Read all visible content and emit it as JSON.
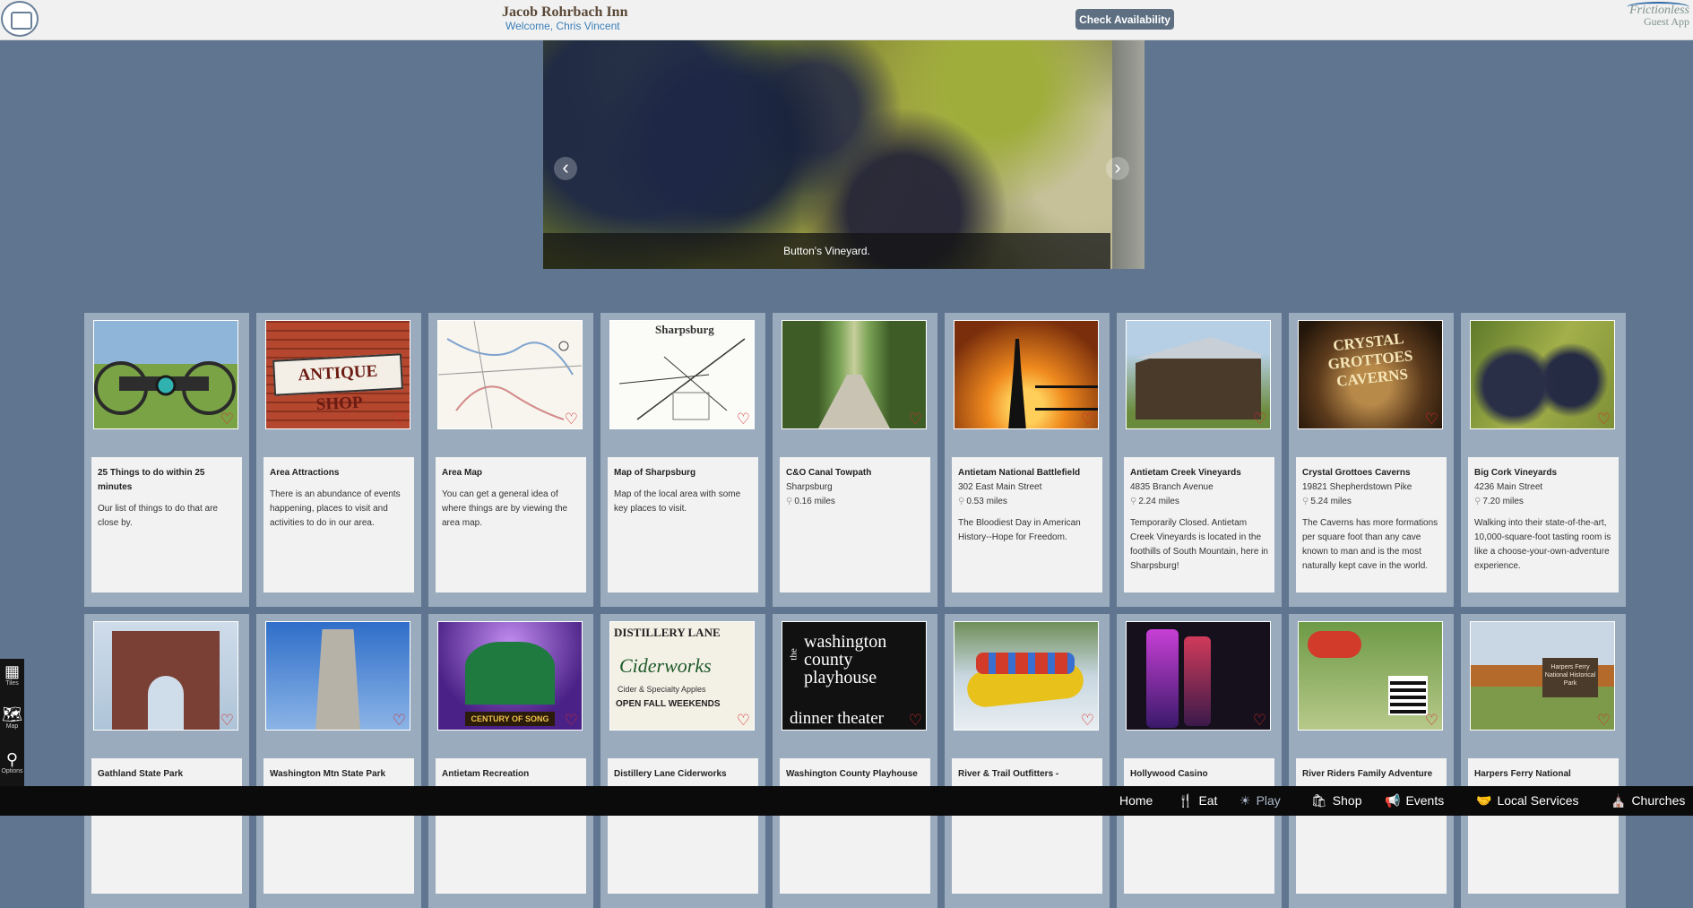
{
  "header": {
    "inn_name": "Jacob Rohrbach Inn",
    "welcome": "Welcome, Chris Vincent",
    "check_button": "Check Availability",
    "brand_line1": "Frictionless",
    "brand_line2": "Guest App"
  },
  "hero": {
    "caption": "Button's Vineyard.",
    "prev_icon": "‹",
    "next_icon": "›"
  },
  "cards_row1": [
    {
      "title": "25 Things to do within 25 minutes",
      "address": "",
      "distance": "",
      "description": "Our list of things to do that are close by."
    },
    {
      "title": "Area Attractions",
      "address": "",
      "distance": "",
      "description": "There is an abundance of events happening, places to visit and activities to do in our area."
    },
    {
      "title": "Area Map",
      "address": "",
      "distance": "",
      "description": "You can get a general idea of where things are by viewing the area map."
    },
    {
      "title": "Map of Sharpsburg",
      "address": "",
      "distance": "",
      "description": "Map of the local area with some key places to visit."
    },
    {
      "title": "C&O Canal Towpath",
      "address": "Sharpsburg",
      "distance": "0.16 miles",
      "description": ""
    },
    {
      "title": "Antietam National Battlefield",
      "address": "302 East Main Street",
      "distance": "0.53 miles",
      "description": "The Bloodiest Day in American History--Hope for Freedom."
    },
    {
      "title": "Antietam Creek Vineyards",
      "address": "4835 Branch Avenue",
      "distance": "2.24 miles",
      "description": "Temporarily Closed. Antietam Creek Vineyards is located in the foothills of South Mountain, here in Sharpsburg!"
    },
    {
      "title": "Crystal Grottoes Caverns",
      "address": "19821 Shepherdstown Pike",
      "distance": "5.24 miles",
      "description": "The Caverns has more formations per square foot than any cave known to man and is the most naturally kept cave in the world."
    },
    {
      "title": "Big Cork Vineyards",
      "address": "4236 Main Street",
      "distance": "7.20 miles",
      "description": "Walking into their state-of-the-art, 10,000-square-foot tasting room is like a choose-your-own-adventure experience."
    }
  ],
  "cards_row2": [
    {
      "title": "Gathland State Park"
    },
    {
      "title": "Washington Mtn State Park"
    },
    {
      "title": "Antietam Recreation"
    },
    {
      "title": "Distillery Lane Ciderworks"
    },
    {
      "title": "Washington County Playhouse"
    },
    {
      "title": "River & Trail Outfitters -"
    },
    {
      "title": "Hollywood Casino"
    },
    {
      "title": "River Riders Family Adventure"
    },
    {
      "title": "Harpers Ferry National"
    }
  ],
  "image_text": {
    "antique": "ANTIQUE SHOP",
    "sharpsburg": "Sharpsburg",
    "crystal": "CRYSTAL GROTTOES CAVERNS",
    "distillery_1": "DISTILLERY LANE",
    "distillery_2": "Ciderworks",
    "distillery_3": "Cider & Specialty Apples",
    "distillery_4": "OPEN FALL WEEKENDS",
    "century": "CENTURY OF SONG",
    "playhouse_1": "the",
    "playhouse_2": "washington",
    "playhouse_3": "county",
    "playhouse_4": "playhouse",
    "playhouse_5": "dinner theater",
    "harpers": "Harpers Ferry National Historical Park"
  },
  "side_tools": {
    "tiles": "Tiles",
    "map": "Map",
    "options": "Options"
  },
  "nav": {
    "home": "Home",
    "eat": "Eat",
    "play": "Play",
    "shop": "Shop",
    "events": "Events",
    "local_services": "Local Services",
    "churches": "Churches"
  },
  "colors": {
    "background": "#5f7590",
    "card": "#9aabbd",
    "heart": "#d42b2b",
    "button": "#5e6f82",
    "bottom_bar": "#0b0b0b"
  }
}
